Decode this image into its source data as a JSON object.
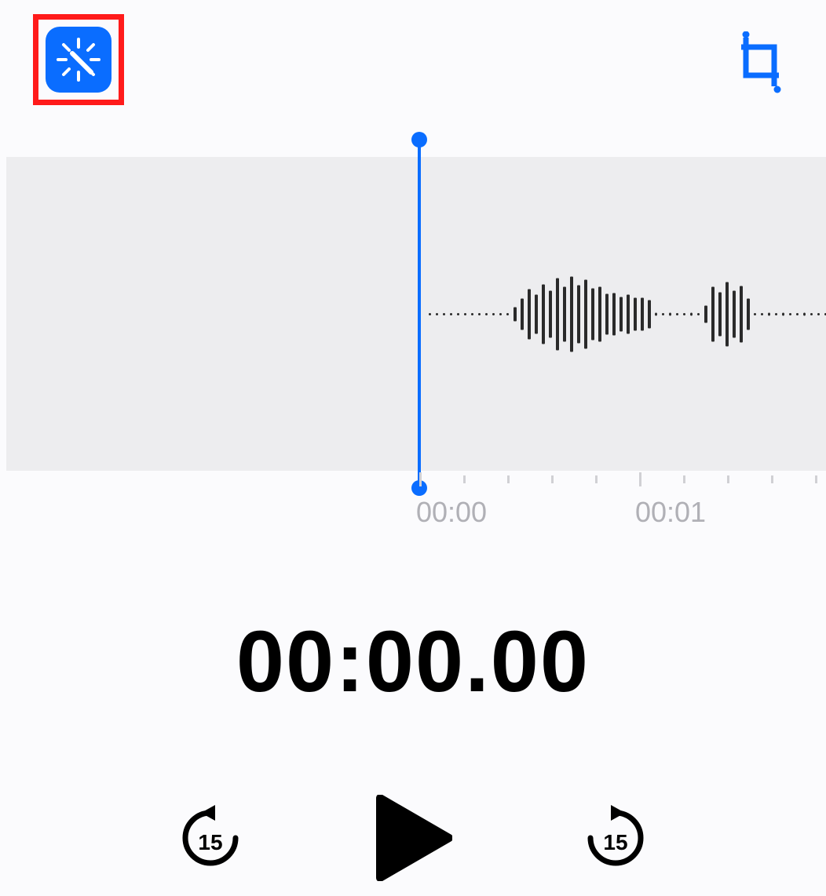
{
  "colors": {
    "accent": "#0a6dff",
    "highlight": "#ff1b1b"
  },
  "header": {
    "enhance_icon": "enhance-wand-icon",
    "crop_icon": "crop-icon"
  },
  "ticks": {
    "labels": [
      "00:00",
      "00:01"
    ]
  },
  "timer": {
    "value": "00:00.00"
  },
  "controls": {
    "skip_back_seconds": "15",
    "skip_forward_seconds": "15"
  },
  "waveform": {
    "samples": [
      2,
      3,
      2,
      3,
      2,
      3,
      2,
      3,
      2,
      3,
      2,
      3,
      18,
      40,
      64,
      50,
      76,
      60,
      92,
      70,
      96,
      74,
      88,
      66,
      70,
      52,
      54,
      44,
      50,
      42,
      42,
      36,
      4,
      3,
      4,
      3,
      3,
      4,
      3,
      22,
      70,
      56,
      82,
      60,
      72,
      40,
      3,
      3,
      4,
      3,
      4,
      3,
      3,
      4,
      3,
      3,
      3
    ],
    "spacing_px": 9
  }
}
